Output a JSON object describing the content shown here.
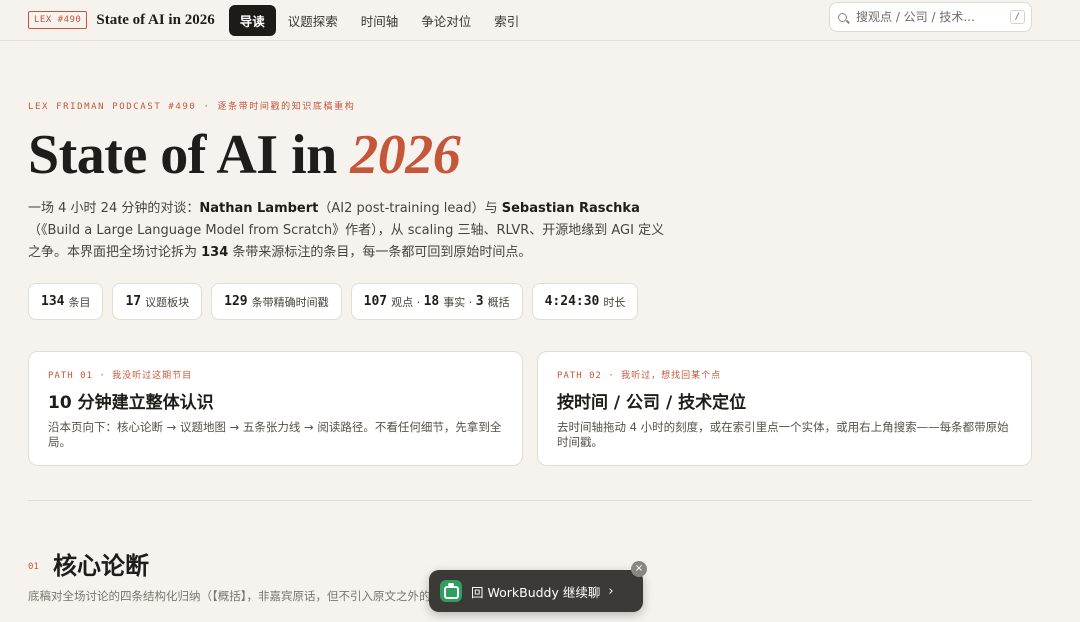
{
  "header": {
    "episode_badge": "LEX #490",
    "brand": "State of AI in 2026",
    "nav": [
      "导读",
      "议题探索",
      "时间轴",
      "争论对位",
      "索引"
    ],
    "active_nav": "导读",
    "search_placeholder": "搜观点 / 公司 / 技术...",
    "search_shortcut": "/"
  },
  "hero": {
    "eyebrow": "LEX FRIDMAN PODCAST #490 · 逐条带时间戳的知识底稿重构",
    "title_main": "State of AI in ",
    "title_accent": "2026",
    "lede": {
      "p1": "一场 4 小时 24 分钟的对谈：",
      "guest1": "Nathan Lambert",
      "p2": "（AI2 post-training lead）与 ",
      "guest2": "Sebastian Raschka",
      "p3": "（《Build a Large Language Model from Scratch》作者），从 scaling 三轴、RLVR、开源地缘到 AGI 定义之争。本界面把全场讨论拆为 ",
      "count": "134",
      "p4": " 条带来源标注的条目，每一条都可回到原始时间点。"
    }
  },
  "stats": [
    {
      "n": "134",
      "label": "条目"
    },
    {
      "n": "17",
      "label": "议题板块"
    },
    {
      "n": "129",
      "label": "条带精确时间戳"
    },
    {
      "n1": "107",
      "l1": "观点 · ",
      "n2": "18",
      "l2": "事实 · ",
      "n3": "3",
      "l3": "概括"
    },
    {
      "n": "4:24:30",
      "label": "时长"
    }
  ],
  "paths": [
    {
      "eyebrow": "PATH 01 · 我没听过这期节目",
      "title": "10 分钟建立整体认识",
      "desc": "沿本页向下：核心论断 → 议题地图 → 五条张力线 → 阅读路径。不看任何细节，先拿到全局。"
    },
    {
      "eyebrow": "PATH 02 · 我听过，想找回某个点",
      "title": "按时间 / 公司 / 技术定位",
      "desc": "去时间轴拖动 4 小时的刻度，或在索引里点一个实体，或用右上角搜索——每条都带原始时间戳。"
    }
  ],
  "section": {
    "num": "01",
    "title": "核心论断",
    "subtitle": "底稿对全场讨论的四条结构化归纳（【概括】，非嘉宾原话，但不引入原文之外的事实）"
  },
  "workbuddy": {
    "label": "回 WorkBuddy 继续聊",
    "chevron": "›",
    "close": "×"
  },
  "colors": {
    "accent": "#c4573a",
    "background": "#f6f3ee",
    "ink": "#1f1d1a"
  }
}
